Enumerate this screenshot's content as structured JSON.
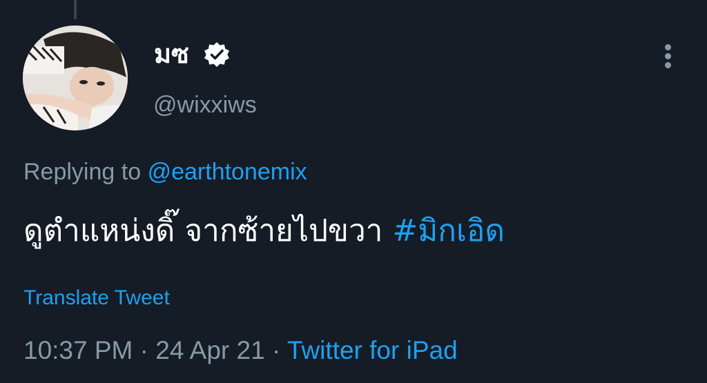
{
  "tweet": {
    "author": {
      "display_name": "มซ",
      "handle": "@wixxiws",
      "verified": true
    },
    "replying_prefix": "Replying to",
    "replying_to": "@earthtonemix",
    "text": "ดูตำแหน่งดิ๊ จากซ้ายไปขวา",
    "hashtag": "#มิกเอิด",
    "translate_label": "Translate Tweet",
    "time": "10:37 PM",
    "separator": "·",
    "date": "24 Apr 21",
    "source": "Twitter for iPad"
  },
  "colors": {
    "background": "#151c26",
    "text_primary": "#ffffff",
    "text_secondary": "#8899a6",
    "accent": "#1da1f2"
  },
  "icons": {
    "verified": "verified-badge-icon",
    "more": "more-vertical-icon"
  }
}
